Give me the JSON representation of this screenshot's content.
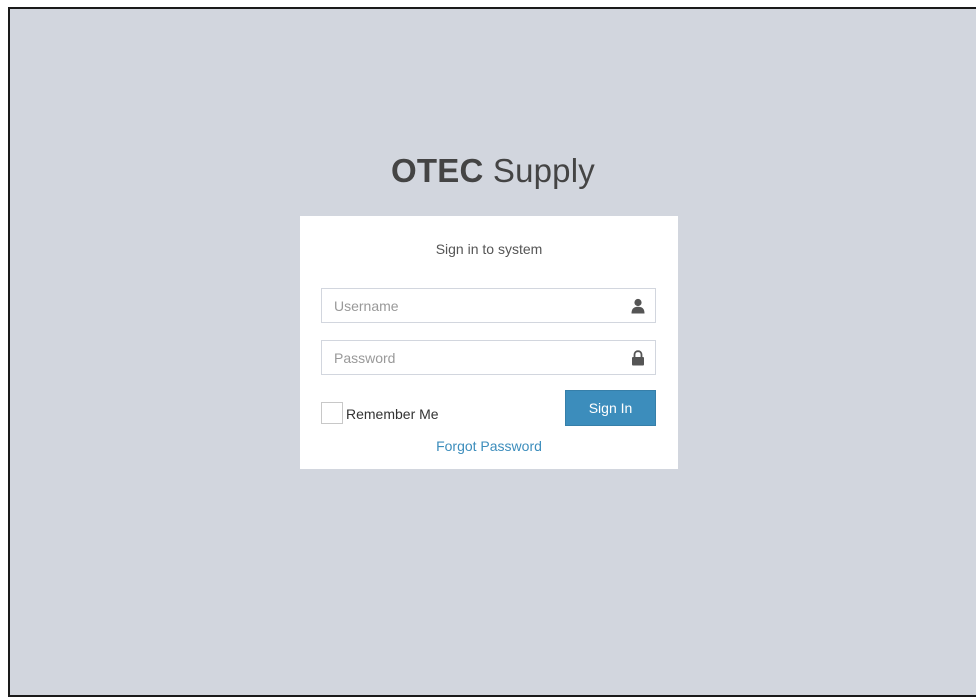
{
  "logo": {
    "bold": "OTEC",
    "light": "Supply"
  },
  "login": {
    "message": "Sign in to system",
    "username": {
      "placeholder": "Username",
      "value": "",
      "icon": "user-icon"
    },
    "password": {
      "placeholder": "Password",
      "value": "",
      "icon": "lock-icon"
    },
    "remember_label": "Remember Me",
    "remember_checked": false,
    "signin_label": "Sign In",
    "forgot_label": "Forgot Password"
  },
  "colors": {
    "background": "#d2d6de",
    "primary_button": "#3c8dbc",
    "link": "#3c8dbc",
    "box": "#ffffff",
    "logo_text": "#444444"
  }
}
